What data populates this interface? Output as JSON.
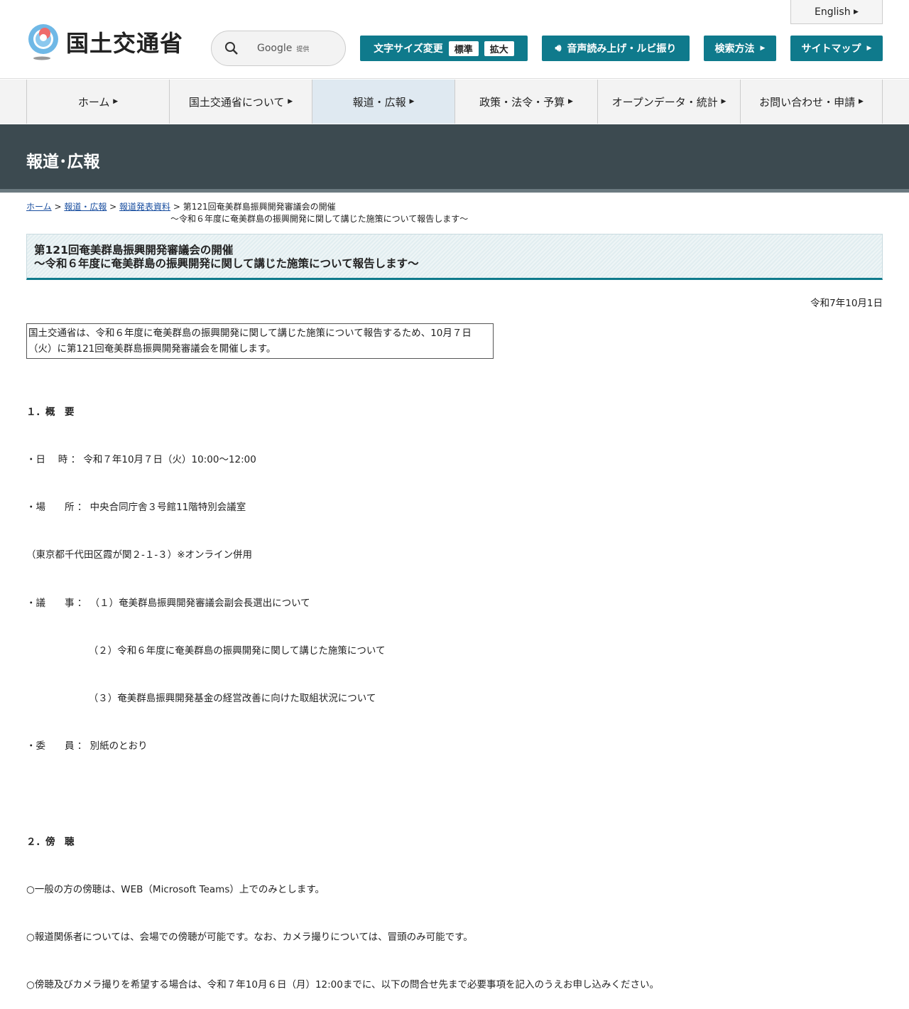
{
  "header": {
    "logo_text": "国土交通省",
    "search": {
      "provider": "Google",
      "provided": "提供"
    },
    "english": "English",
    "font_size": {
      "label": "文字サイズ変更",
      "standard": "標準",
      "large": "拡大"
    },
    "speech": "音声読み上げ・ルビ振り",
    "search_method": "検索方法",
    "sitemap": "サイトマップ"
  },
  "nav": [
    "ホーム",
    "国土交通省について",
    "報道・広報",
    "政策・法令・予算",
    "オープンデータ・統計",
    "お問い合わせ・申請"
  ],
  "banner": "報道･広報",
  "breadcrumb": {
    "home": "ホーム",
    "press": "報道・広報",
    "releases": "報道発表資料",
    "current1": "第121回奄美群島振興開発審議会の開催",
    "current2": "～令和６年度に奄美群島の振興開発に関して講じた施策について報告します～"
  },
  "title": {
    "line1": "第121回奄美群島振興開発審議会の開催",
    "line2": "～令和６年度に奄美群島の振興開発に関して講じた施策について報告します～"
  },
  "date": "令和7年10月1日",
  "lead": "国土交通省は、令和６年度に奄美群島の振興開発に関して講じた施策について報告するため、10月７日（火）に第121回奄美群島振興開発審議会を開催します。",
  "body": [
    {
      "text": "１．概　要",
      "bold": true
    },
    {
      "text": "・日　 時 ： 令和７年10月７日（火）10:00～12:00"
    },
    {
      "text": "・場　　所 ： 中央合同庁舎３号館11階特別会議室"
    },
    {
      "text": "（東京都千代田区霞が関２-１-３）※オンライン併用"
    },
    {
      "text": "・議　　事 ： （１）奄美群島振興開発審議会副会長選出について"
    },
    {
      "text": "　　　　　　　（２）令和６年度に奄美群島の振興開発に関して講じた施策について"
    },
    {
      "text": "　　　　　　　（３）奄美群島振興開発基金の経営改善に向けた取組状況について"
    },
    {
      "text": "・委　　員 ： 別紙のとおり"
    },
    {
      "text": ""
    },
    {
      "text": "２．傍　聴",
      "bold": true
    },
    {
      "text": "○一般の方の傍聴は、WEB（Microsoft Teams）上でのみとします。"
    },
    {
      "text": "○報道関係者については、会場での傍聴が可能です。なお、カメラ撮りについては、冒頭のみ可能です。"
    },
    {
      "text": "○傍聴及びカメラ撮りを希望する場合は、令和７年10月６日（月）12:00までに、以下の問合せ先まで必要事項を記入のうえお申し込みください。"
    }
  ]
}
